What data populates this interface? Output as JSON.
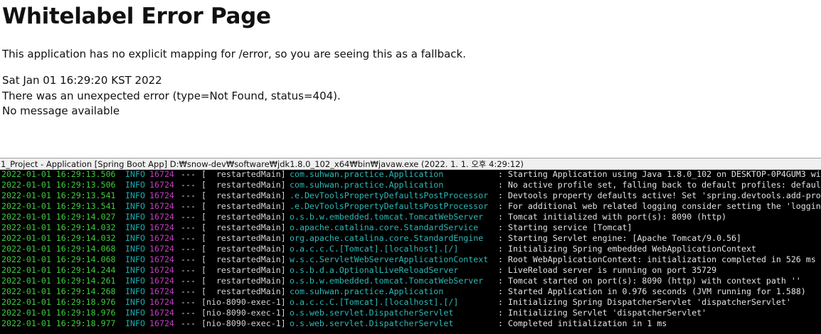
{
  "error_page": {
    "title": "Whitelabel Error Page",
    "message": "This application has no explicit mapping for /error, so you are seeing this as a fallback.",
    "timestamp": "Sat Jan 01 16:29:20 KST 2022",
    "error_line": "There was an unexpected error (type=Not Found, status=404).",
    "detail": "No message available"
  },
  "console": {
    "title": "1_Project - Application [Spring Boot App] D:₩snow-dev₩software₩jdk1.8.0_102_x64₩bin₩javaw.exe (2022. 1. 1. 오후 4:29:12)",
    "colors": {
      "background": "#000000",
      "timestamp": "#3ecc3e",
      "level": "#17b0b0",
      "pid": "#c43fc4",
      "logger": "#2fb8b8",
      "text": "#e3e3e3"
    },
    "rows": [
      {
        "ts": "2022-01-01 16:29:13.506",
        "level": "INFO",
        "pid": "16724",
        "sep": "---",
        "thread": "[  restartedMain]",
        "logger": "com.suhwan.practice.Application",
        "message": ": Starting Application using Java 1.8.0_102 on DESKTOP-0P4GUM3 wit"
      },
      {
        "ts": "2022-01-01 16:29:13.506",
        "level": "INFO",
        "pid": "16724",
        "sep": "---",
        "thread": "[  restartedMain]",
        "logger": "com.suhwan.practice.Application",
        "message": ": No active profile set, falling back to default profiles: default"
      },
      {
        "ts": "2022-01-01 16:29:13.541",
        "level": "INFO",
        "pid": "16724",
        "sep": "---",
        "thread": "[  restartedMain]",
        "logger": ".e.DevToolsPropertyDefaultsPostProcessor",
        "message": ": Devtools property defaults active! Set 'spring.devtools.add-prop"
      },
      {
        "ts": "2022-01-01 16:29:13.541",
        "level": "INFO",
        "pid": "16724",
        "sep": "---",
        "thread": "[  restartedMain]",
        "logger": ".e.DevToolsPropertyDefaultsPostProcessor",
        "message": ": For additional web related logging consider setting the 'logging"
      },
      {
        "ts": "2022-01-01 16:29:14.027",
        "level": "INFO",
        "pid": "16724",
        "sep": "---",
        "thread": "[  restartedMain]",
        "logger": "o.s.b.w.embedded.tomcat.TomcatWebServer",
        "message": ": Tomcat initialized with port(s): 8090 (http)"
      },
      {
        "ts": "2022-01-01 16:29:14.032",
        "level": "INFO",
        "pid": "16724",
        "sep": "---",
        "thread": "[  restartedMain]",
        "logger": "o.apache.catalina.core.StandardService",
        "message": ": Starting service [Tomcat]"
      },
      {
        "ts": "2022-01-01 16:29:14.032",
        "level": "INFO",
        "pid": "16724",
        "sep": "---",
        "thread": "[  restartedMain]",
        "logger": "org.apache.catalina.core.StandardEngine",
        "message": ": Starting Servlet engine: [Apache Tomcat/9.0.56]"
      },
      {
        "ts": "2022-01-01 16:29:14.068",
        "level": "INFO",
        "pid": "16724",
        "sep": "---",
        "thread": "[  restartedMain]",
        "logger": "o.a.c.c.C.[Tomcat].[localhost].[/]",
        "message": ": Initializing Spring embedded WebApplicationContext"
      },
      {
        "ts": "2022-01-01 16:29:14.068",
        "level": "INFO",
        "pid": "16724",
        "sep": "---",
        "thread": "[  restartedMain]",
        "logger": "w.s.c.ServletWebServerApplicationContext",
        "message": ": Root WebApplicationContext: initialization completed in 526 ms"
      },
      {
        "ts": "2022-01-01 16:29:14.244",
        "level": "INFO",
        "pid": "16724",
        "sep": "---",
        "thread": "[  restartedMain]",
        "logger": "o.s.b.d.a.OptionalLiveReloadServer",
        "message": ": LiveReload server is running on port 35729"
      },
      {
        "ts": "2022-01-01 16:29:14.261",
        "level": "INFO",
        "pid": "16724",
        "sep": "---",
        "thread": "[  restartedMain]",
        "logger": "o.s.b.w.embedded.tomcat.TomcatWebServer",
        "message": ": Tomcat started on port(s): 8090 (http) with context path ''"
      },
      {
        "ts": "2022-01-01 16:29:14.268",
        "level": "INFO",
        "pid": "16724",
        "sep": "---",
        "thread": "[  restartedMain]",
        "logger": "com.suhwan.practice.Application",
        "message": ": Started Application in 0.976 seconds (JVM running for 1.588)"
      },
      {
        "ts": "2022-01-01 16:29:18.976",
        "level": "INFO",
        "pid": "16724",
        "sep": "---",
        "thread": "[nio-8090-exec-1]",
        "logger": "o.a.c.c.C.[Tomcat].[localhost].[/]",
        "message": ": Initializing Spring DispatcherServlet 'dispatcherServlet'"
      },
      {
        "ts": "2022-01-01 16:29:18.976",
        "level": "INFO",
        "pid": "16724",
        "sep": "---",
        "thread": "[nio-8090-exec-1]",
        "logger": "o.s.web.servlet.DispatcherServlet",
        "message": ": Initializing Servlet 'dispatcherServlet'"
      },
      {
        "ts": "2022-01-01 16:29:18.977",
        "level": "INFO",
        "pid": "16724",
        "sep": "---",
        "thread": "[nio-8090-exec-1]",
        "logger": "o.s.web.servlet.DispatcherServlet",
        "message": ": Completed initialization in 1 ms"
      }
    ]
  }
}
